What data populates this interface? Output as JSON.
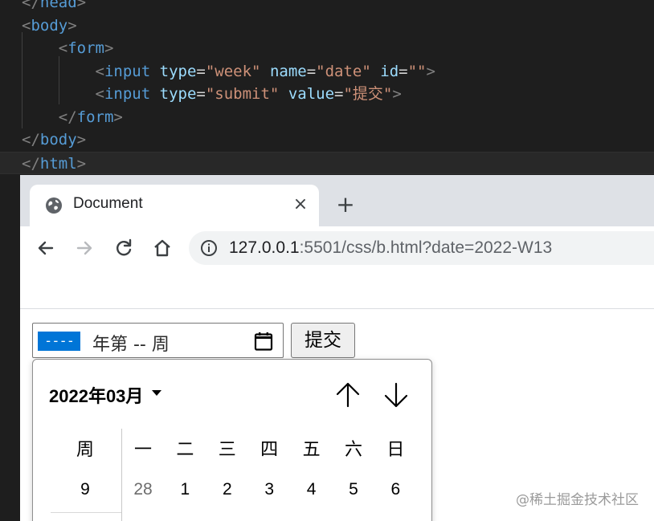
{
  "editor": {
    "lines": [
      {
        "indent": "",
        "close": true,
        "tag": "head"
      },
      {
        "indent": "",
        "close": false,
        "tag": "body"
      },
      {
        "indent": "    ",
        "close": false,
        "tag": "form"
      },
      {
        "indent": "        ",
        "tag": "input",
        "attrs": [
          {
            "name": "type",
            "value": "\"week\""
          },
          {
            "name": "name",
            "value": "\"date\""
          },
          {
            "name": "id",
            "value": "\"\""
          }
        ]
      },
      {
        "indent": "        ",
        "tag": "input",
        "attrs": [
          {
            "name": "type",
            "value": "\"submit\""
          },
          {
            "name": "value",
            "value": "\"提交\""
          }
        ]
      },
      {
        "indent": "    ",
        "close": true,
        "tag": "form"
      },
      {
        "indent": "",
        "close": true,
        "tag": "body"
      },
      {
        "indent": "",
        "close": true,
        "tag": "html"
      }
    ]
  },
  "browser": {
    "tab_title": "Document",
    "tab_close": "×",
    "new_tab": "+",
    "url_host": "127.0.0.1",
    "url_rest": ":5501/css/b.html?date=2022-W13"
  },
  "form": {
    "year_placeholder": "----",
    "week_text": "年第 -- 周",
    "submit_label": "提交"
  },
  "picker": {
    "month_label": "2022年03月",
    "week_header": "周",
    "weekdays": [
      "一",
      "二",
      "三",
      "四",
      "五",
      "六",
      "日"
    ],
    "week_number": "9",
    "days": [
      {
        "d": "28",
        "muted": true
      },
      {
        "d": "1",
        "muted": false
      },
      {
        "d": "2",
        "muted": false
      },
      {
        "d": "3",
        "muted": false
      },
      {
        "d": "4",
        "muted": false
      },
      {
        "d": "5",
        "muted": false
      },
      {
        "d": "6",
        "muted": false
      }
    ]
  },
  "watermark": "@稀土掘金技术社区",
  "colors": {
    "selection": "#0075d7",
    "tag": "#569cd6",
    "attr": "#9cdcfe",
    "string": "#ce9178"
  }
}
